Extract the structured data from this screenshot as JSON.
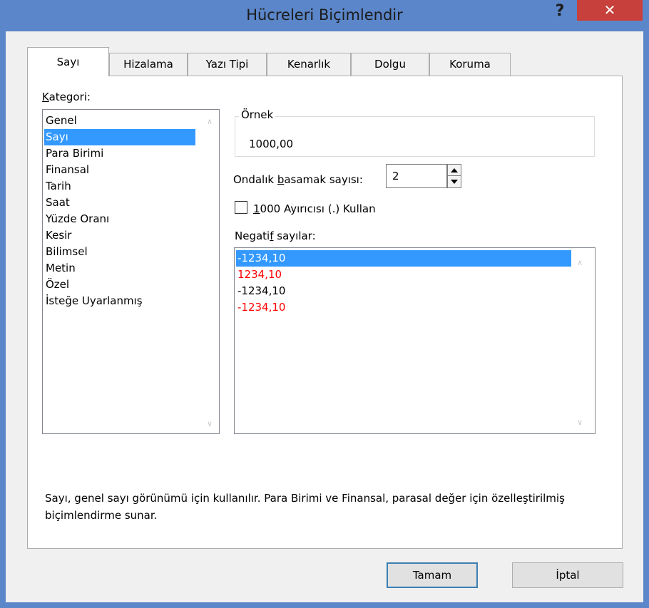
{
  "window": {
    "title": "Hücreleri Biçimlendir",
    "help_label": "?",
    "close_label": "✕"
  },
  "tabs": [
    {
      "label": "Sayı"
    },
    {
      "label": "Hizalama"
    },
    {
      "label": "Yazı Tipi"
    },
    {
      "label": "Kenarlık"
    },
    {
      "label": "Dolgu"
    },
    {
      "label": "Koruma"
    }
  ],
  "category": {
    "label_prefix": "",
    "label_hotkey": "K",
    "label_rest": "ategori:",
    "items": [
      {
        "label": "Genel"
      },
      {
        "label": "Sayı"
      },
      {
        "label": "Para Birimi"
      },
      {
        "label": "Finansal"
      },
      {
        "label": "Tarih"
      },
      {
        "label": "Saat"
      },
      {
        "label": "Yüzde Oranı"
      },
      {
        "label": "Kesir"
      },
      {
        "label": "Bilimsel"
      },
      {
        "label": "Metin"
      },
      {
        "label": "Özel"
      },
      {
        "label": "İsteğe Uyarlanmış"
      }
    ],
    "selected": "Sayı"
  },
  "sample": {
    "title": "Örnek",
    "value": "1000,00"
  },
  "decimals": {
    "label_prefix": "Ondalık ",
    "label_hotkey": "b",
    "label_rest": "asamak sayısı:",
    "value": "2"
  },
  "separator": {
    "label_hotkey": "1",
    "label_rest": "000 Ayırıcısı (.) Kullan",
    "checked": false
  },
  "negative": {
    "label_prefix": "Negati",
    "label_hotkey": "f",
    "label_rest": " sayılar:",
    "items": [
      {
        "label": "-1234,10",
        "color": "#000000"
      },
      {
        "label": "1234,10",
        "color": "#ff0000"
      },
      {
        "label": "-1234,10",
        "color": "#000000"
      },
      {
        "label": "-1234,10",
        "color": "#ff0000"
      }
    ],
    "selected_index": 0
  },
  "description": "Sayı, genel sayı görünümü için kullanılır. Para Birimi ve Finansal, parasal değer için özelleştirilmiş biçimlendirme sunar.",
  "buttons": {
    "ok": "Tamam",
    "cancel": "İptal"
  },
  "colors": {
    "title_bar": "#5b86c9",
    "close_button": "#c7403b",
    "selection": "#3399ff",
    "negative_red": "#ff0000"
  }
}
